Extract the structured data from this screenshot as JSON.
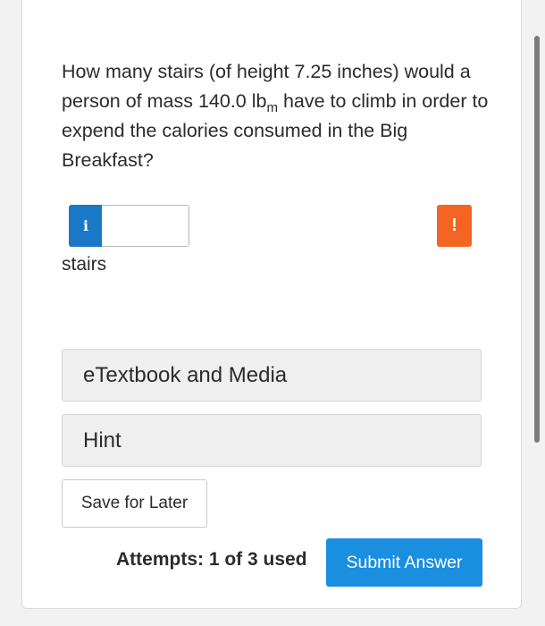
{
  "question": {
    "part1": "How many stairs (of height 7.25 inches) would a person of mass 140.0 lb",
    "mass_unit_subscript": "m",
    "part2": " have to climb in order to expend the calories consumed in the Big Breakfast?"
  },
  "answer": {
    "info_icon_glyph": "i",
    "value": "",
    "placeholder": "",
    "warning_icon_glyph": "!",
    "unit": "stairs"
  },
  "panels": {
    "etextbook_label": "eTextbook and Media",
    "hint_label": "Hint"
  },
  "actions": {
    "save_label": "Save for Later",
    "attempts_text": "Attempts: 1 of 3 used",
    "submit_label": "Submit Answer"
  },
  "colors": {
    "info_blue": "#1a78c6",
    "warning_orange": "#f26522",
    "submit_blue": "#1a8fe0"
  },
  "icons": {
    "info": "info-icon",
    "warning": "warning-icon"
  }
}
